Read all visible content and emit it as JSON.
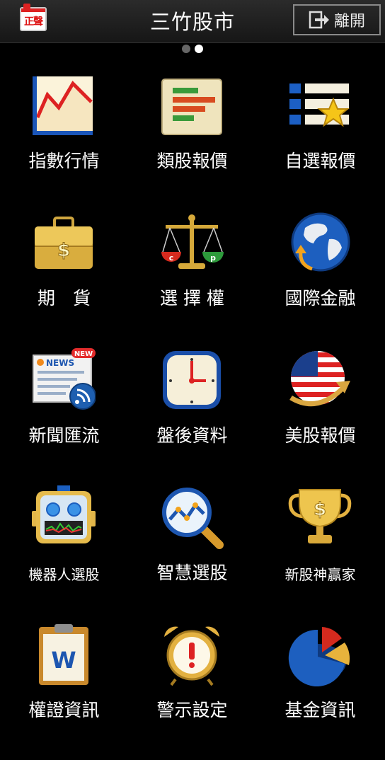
{
  "header": {
    "brand_badge": "正聲",
    "title": "三竹股市",
    "logout_label": "離開"
  },
  "pager": {
    "pages": 2,
    "current": 2
  },
  "menu": [
    {
      "label": "指數行情",
      "icon": "line-chart-icon"
    },
    {
      "label": "類股報價",
      "icon": "sector-bars-icon"
    },
    {
      "label": "自選報價",
      "icon": "watchlist-star-icon"
    },
    {
      "label": "期　貨",
      "icon": "briefcase-dollar-icon"
    },
    {
      "label": "選 擇 權",
      "icon": "scale-cp-icon"
    },
    {
      "label": "國際金融",
      "icon": "globe-icon"
    },
    {
      "label": "新聞匯流",
      "icon": "news-rss-icon",
      "badge": "NEW",
      "sub": "NEWS"
    },
    {
      "label": "盤後資料",
      "icon": "clock-icon"
    },
    {
      "label": "美股報價",
      "icon": "us-flag-globe-icon"
    },
    {
      "label": "機器人選股",
      "icon": "robot-icon"
    },
    {
      "label": "智慧選股",
      "icon": "magnifier-chart-icon"
    },
    {
      "label": "新股神贏家",
      "icon": "trophy-dollar-icon"
    },
    {
      "label": "權證資訊",
      "icon": "clipboard-w-icon",
      "sub": "W"
    },
    {
      "label": "警示設定",
      "icon": "alarm-clock-icon"
    },
    {
      "label": "基金資訊",
      "icon": "pie-chart-icon"
    }
  ]
}
